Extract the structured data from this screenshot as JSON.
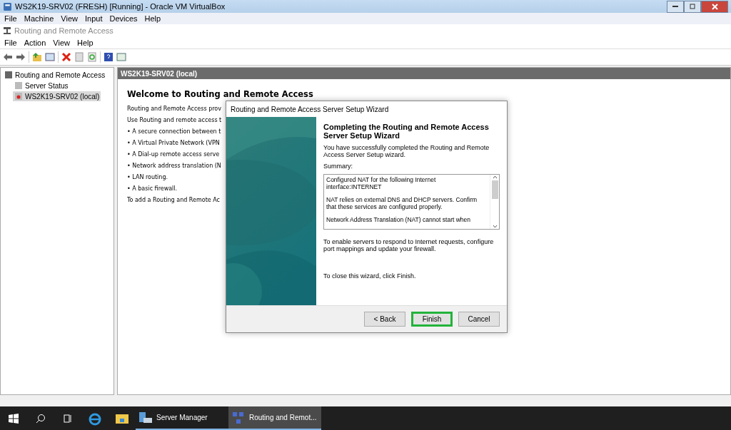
{
  "host_window": {
    "title": "WS2K19-SRV02 (FRESH) [Running] - Oracle VM VirtualBox",
    "menu": [
      "File",
      "Machine",
      "View",
      "Input",
      "Devices",
      "Help"
    ]
  },
  "app_window": {
    "title": "Routing and Remote Access",
    "menu": [
      "File",
      "Action",
      "View",
      "Help"
    ]
  },
  "tree": [
    {
      "label": "Routing and Remote Access",
      "selected": false,
      "children": [
        {
          "label": "Server Status",
          "selected": false
        },
        {
          "label": "WS2K19-SRV02 (local)",
          "selected": true
        }
      ]
    }
  ],
  "pane": {
    "header": "WS2K19-SRV02 (local)",
    "heading": "Welcome to Routing and Remote Access",
    "lines": [
      "Routing and Remote Access prov",
      "Use Routing and remote access t",
      "• A secure connection between t",
      "• A Virtual Private Network (VPN",
      "• A Dial-up remote access serve",
      "• Network address translation (N",
      "• LAN routing.",
      "• A basic firewall.",
      "To add a Routing and Remote Ac"
    ]
  },
  "wizard": {
    "title": "Routing and Remote Access Server Setup Wizard",
    "heading": "Completing the Routing and Remote Access Server Setup Wizard",
    "intro": "You have successfully completed the Routing and Remote Access Server Setup wizard.",
    "summary_label": "Summary:",
    "summary": [
      "Configured NAT for the following Internet interface:INTERNET",
      "NAT relies on external DNS and DHCP servers. Confirm that these services are configured properly.",
      "Network Address Translation (NAT) cannot start when"
    ],
    "note": "To enable servers to respond to Internet requests, configure port mappings and update your firewall.",
    "close_hint": "To close this wizard, click Finish.",
    "buttons": [
      {
        "label": "< Back",
        "highlighted": false
      },
      {
        "label": "Finish",
        "highlighted": true
      },
      {
        "label": "Cancel",
        "highlighted": false
      }
    ]
  },
  "taskbar": {
    "apps": [
      {
        "label": "Server Manager",
        "selected": false
      },
      {
        "label": "Routing and Remot...",
        "selected": true
      }
    ]
  }
}
